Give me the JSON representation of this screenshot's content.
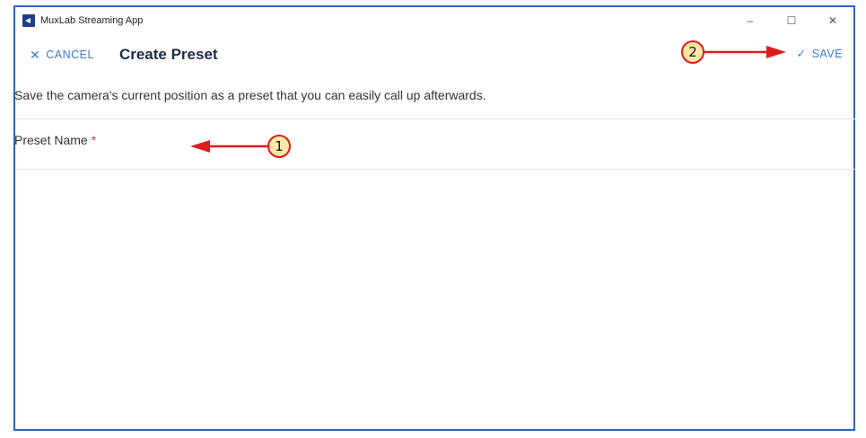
{
  "window": {
    "title": "MuxLab Streaming App",
    "icon": "muxlab-app-icon",
    "controls": {
      "minimize": "–",
      "maximize": "☐",
      "close": "✕"
    }
  },
  "toolbar": {
    "cancel_icon": "✕",
    "cancel_label": "CANCEL",
    "title": "Create Preset",
    "save_icon": "✓",
    "save_label": "SAVE"
  },
  "description": "Save the camera's current position as a preset that you can easily call up afterwards.",
  "form": {
    "preset_name_label": "Preset Name",
    "required_marker": "*",
    "preset_name_value": ""
  },
  "annotations": {
    "one": "1",
    "two": "2"
  },
  "colors": {
    "accent": "#3a7bd5",
    "window_border": "#2b64c4",
    "required": "#e53935",
    "annotation_red": "#e01b1b",
    "badge_fill": "#fde7a8"
  }
}
